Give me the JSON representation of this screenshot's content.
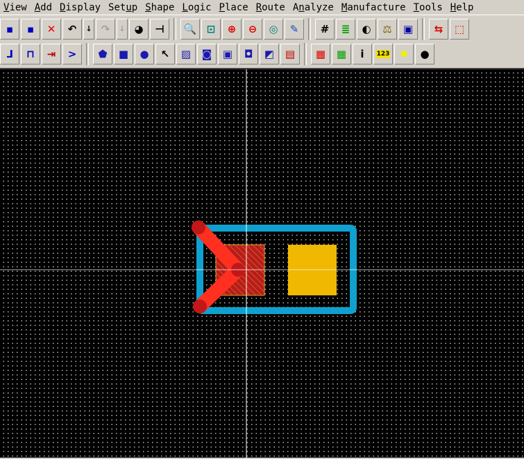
{
  "menu": [
    {
      "pre": "",
      "u": "V",
      "post": "iew"
    },
    {
      "pre": "",
      "u": "A",
      "post": "dd"
    },
    {
      "pre": "",
      "u": "D",
      "post": "isplay"
    },
    {
      "pre": "Set",
      "u": "u",
      "post": "p"
    },
    {
      "pre": "",
      "u": "S",
      "post": "hape"
    },
    {
      "pre": "",
      "u": "L",
      "post": "ogic"
    },
    {
      "pre": "",
      "u": "P",
      "post": "lace"
    },
    {
      "pre": "",
      "u": "R",
      "post": "oute"
    },
    {
      "pre": "A",
      "u": "n",
      "post": "alyze"
    },
    {
      "pre": "",
      "u": "M",
      "post": "anufacture"
    },
    {
      "pre": "",
      "u": "T",
      "post": "ools"
    },
    {
      "pre": "",
      "u": "H",
      "post": "elp"
    }
  ],
  "toolbar1": [
    {
      "icon": "move-icon",
      "glyph": "▪",
      "color": "#0000c0"
    },
    {
      "icon": "copy-icon",
      "glyph": "▪",
      "color": "#0000c0"
    },
    {
      "icon": "delete-icon",
      "glyph": "✕",
      "color": "#e00000"
    },
    {
      "icon": "undo-icon",
      "glyph": "↶",
      "color": "#000"
    },
    {
      "icon": "undo-dropdown-icon",
      "glyph": "↓",
      "color": "#000",
      "small": true
    },
    {
      "icon": "redo-icon",
      "glyph": "↷",
      "color": "#a0a0a0",
      "disabled": true
    },
    {
      "icon": "redo-dropdown-icon",
      "glyph": "↓",
      "color": "#a0a0a0",
      "small": true,
      "disabled": true
    },
    {
      "icon": "rubber-band-icon",
      "glyph": "◕",
      "color": "#000"
    },
    {
      "icon": "pin-icon",
      "glyph": "⊣",
      "color": "#000"
    },
    {
      "sep": true
    },
    {
      "icon": "zoom-by-points-icon",
      "glyph": "🔍",
      "color": "#008080"
    },
    {
      "icon": "zoom-fit-icon",
      "glyph": "⊡",
      "color": "#008080"
    },
    {
      "icon": "zoom-in-icon",
      "glyph": "⊕",
      "color": "#e00000"
    },
    {
      "icon": "zoom-out-icon",
      "glyph": "⊖",
      "color": "#e00000"
    },
    {
      "icon": "zoom-previous-icon",
      "glyph": "◎",
      "color": "#008080"
    },
    {
      "icon": "redraw-icon",
      "glyph": "✎",
      "color": "#1050c0"
    },
    {
      "sep": true
    },
    {
      "icon": "grid-icon",
      "glyph": "#",
      "color": "#000"
    },
    {
      "icon": "layers-icon",
      "glyph": "≣",
      "color": "#00a000"
    },
    {
      "icon": "color-visibility-icon",
      "glyph": "◐",
      "color": "#000"
    },
    {
      "icon": "balance-icon",
      "glyph": "⚖",
      "color": "#806000"
    },
    {
      "icon": "board-outline-icon",
      "glyph": "▣",
      "color": "#0000a0"
    },
    {
      "sep": true
    },
    {
      "icon": "swap-components-icon",
      "glyph": "⇆",
      "color": "#e00000"
    },
    {
      "icon": "placement-outline-icon",
      "glyph": "⬚",
      "color": "#e00000"
    }
  ],
  "toolbar2": [
    {
      "icon": "add-connect-icon",
      "glyph": "⅃",
      "color": "#0000c0"
    },
    {
      "icon": "slide-icon",
      "glyph": "⊓",
      "color": "#0000c0"
    },
    {
      "icon": "delay-tune-icon",
      "glyph": "⇥",
      "color": "#c00000"
    },
    {
      "icon": "fanout-icon",
      "glyph": ">",
      "color": "#0000c0"
    },
    {
      "sep": true
    },
    {
      "icon": "shape-polygon-icon",
      "glyph": "⬟",
      "color": "#1a1ab0"
    },
    {
      "icon": "shape-rectangle-icon",
      "glyph": "■",
      "color": "#1a1ab0"
    },
    {
      "icon": "shape-circle-icon",
      "glyph": "●",
      "color": "#1a1ab0"
    },
    {
      "icon": "select-shape-icon",
      "glyph": "↖",
      "color": "#000"
    },
    {
      "icon": "manual-void-icon",
      "glyph": "▨",
      "color": "#1a1ab0"
    },
    {
      "icon": "void-circle-icon",
      "glyph": "◙",
      "color": "#1a1ab0"
    },
    {
      "icon": "void-rectangle-icon",
      "glyph": "▣",
      "color": "#1a1ab0"
    },
    {
      "icon": "void-polygon-icon",
      "glyph": "◘",
      "color": "#1a1ab0"
    },
    {
      "icon": "shape-edit-icon",
      "glyph": "◩",
      "color": "#1a1ab0"
    },
    {
      "icon": "delete-islands-icon",
      "glyph": "▤",
      "color": "#c00000"
    },
    {
      "sep": true
    },
    {
      "icon": "color-palette-icon",
      "glyph": "▦",
      "color": "#e00000"
    },
    {
      "icon": "assign-color-icon",
      "glyph": "▦",
      "color": "#00a000"
    },
    {
      "icon": "show-element-icon",
      "glyph": "i",
      "color": "#000"
    },
    {
      "icon": "measure-icon",
      "glyph": "123",
      "color": "#000"
    },
    {
      "icon": "highlight-icon",
      "glyph": "✹",
      "color": "#f0f000"
    },
    {
      "icon": "dehighlight-icon",
      "glyph": "●",
      "color": "#000"
    }
  ],
  "colors": {
    "outline": "#10a0d0",
    "pad_left": "#c02020",
    "pad_right": "#f0b800",
    "trace": "#ff3020",
    "trace_end": "#c01818",
    "crosshair": "#ffffff"
  }
}
